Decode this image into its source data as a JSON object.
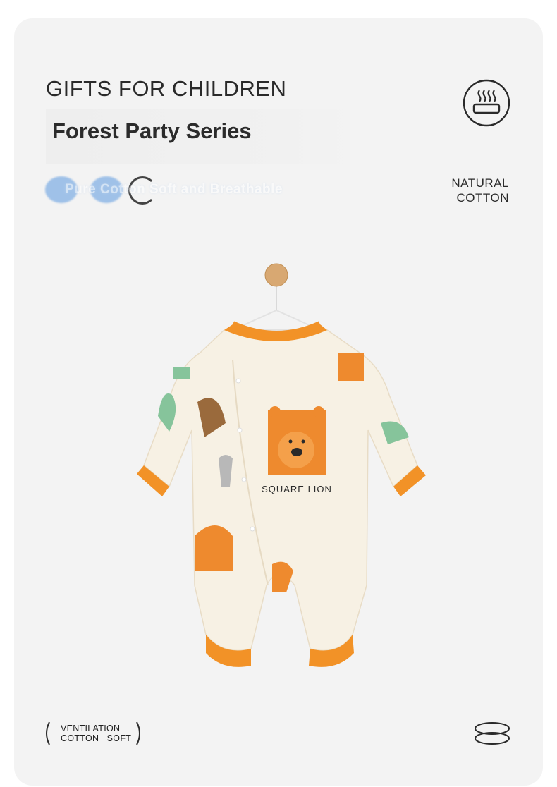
{
  "header": {
    "eyebrow": "GIFTS FOR CHILDREN",
    "title": "Forest Party Series",
    "feature": "Pure Cotton Soft and Breathable"
  },
  "badge": {
    "line1": "NATURAL",
    "line2": "COTTON"
  },
  "product": {
    "print_text": "SQUARE LION",
    "colors": {
      "accent": "#f29227",
      "body": "#f7f1e4",
      "lion": "#ee8a2e"
    }
  },
  "footer": {
    "left_line1": "VENTILATION",
    "left_line2": "COTTON   SOFT"
  },
  "icons": [
    "heat-steam-icon",
    "hanger-icon",
    "stacked-rings-icon"
  ]
}
